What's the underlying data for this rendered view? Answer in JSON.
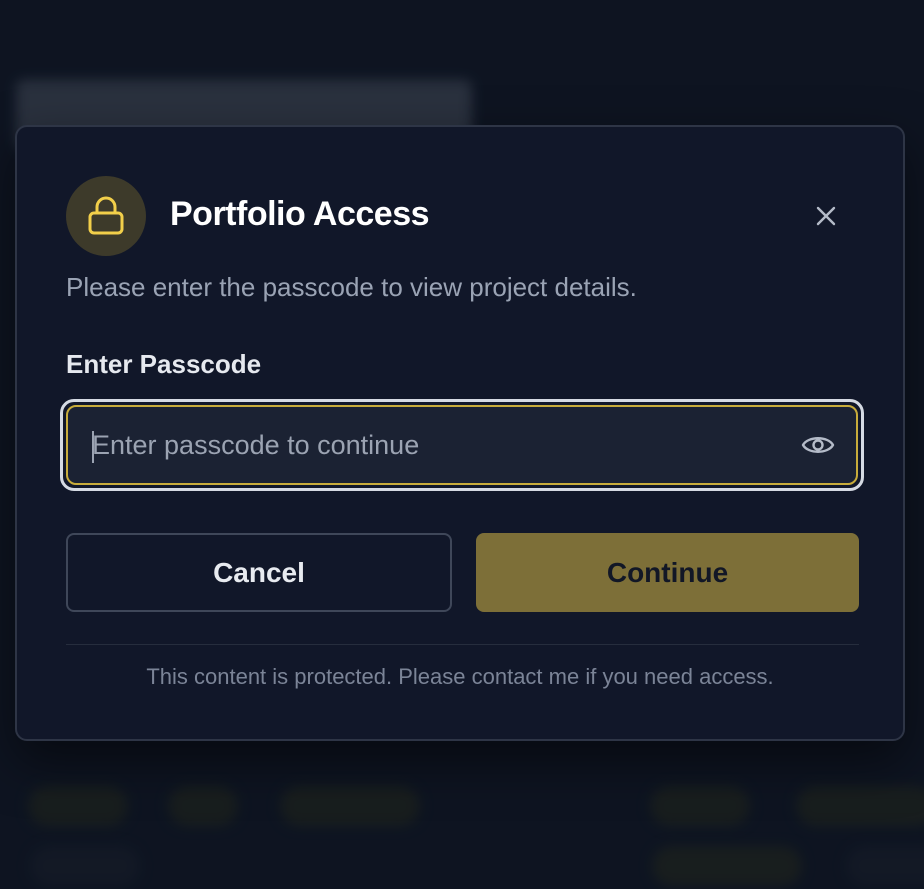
{
  "modal": {
    "title": "Portfolio Access",
    "subtitle": "Please enter the passcode to view project details.",
    "lock_icon": "lock-icon",
    "close_icon": "close-icon",
    "field_label": "Enter Passcode",
    "input": {
      "placeholder": "Enter passcode to continue",
      "value": "",
      "toggle_icon": "eye-icon"
    },
    "cancel_label": "Cancel",
    "continue_label": "Continue",
    "footer_note": "This content is protected. Please contact me if you need access."
  },
  "colors": {
    "accent": "#c8ac3b",
    "continue_bg": "#7d6f38",
    "modal_bg": "#111729",
    "lock_circle_bg": "#3d3a2a",
    "lock_icon": "#f2cf4a"
  }
}
